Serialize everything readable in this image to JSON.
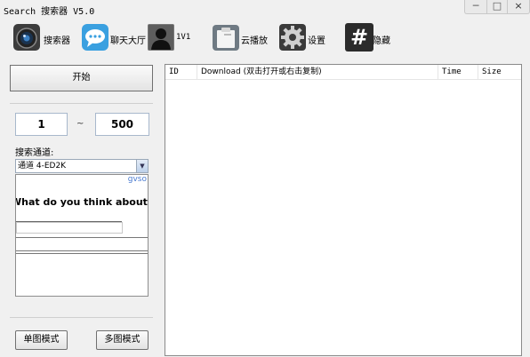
{
  "window": {
    "title": "Search 搜索器 V5.0",
    "minimize": "─",
    "maximize": "□",
    "close": "×"
  },
  "toolbar": {
    "items": [
      {
        "label": "搜索器",
        "icon": "camera-lens-icon"
      },
      {
        "label": "聊天大厅",
        "icon": "chat-bubble-icon"
      },
      {
        "label": "1V1",
        "icon": "user-silhouette-icon"
      },
      {
        "label": "云播放",
        "icon": "clipboard-icon"
      },
      {
        "label": "设置",
        "icon": "gear-icon"
      },
      {
        "label": "隐藏",
        "icon": "hash-icon"
      }
    ],
    "hash_glyph": "#"
  },
  "left": {
    "start_label": "开始",
    "range_from": "1",
    "range_sep": "~",
    "range_to": "500",
    "channel_label": "搜索通道:",
    "channel_value": "通道 4-ED2K",
    "ad": {
      "brand": "gvso",
      "question": "What do you think about c"
    },
    "single_mode": "单图模式",
    "multi_mode": "多图模式"
  },
  "results": {
    "columns": [
      "ID",
      "Download (双击打开或右击复制)",
      "Time",
      "Size"
    ],
    "rows": []
  },
  "colors": {
    "window_bg": "#f0f0f0",
    "chat_icon": "#3aa0e0",
    "hash_icon": "#2b2b2b",
    "ad_brand": "#4a7bd0"
  }
}
